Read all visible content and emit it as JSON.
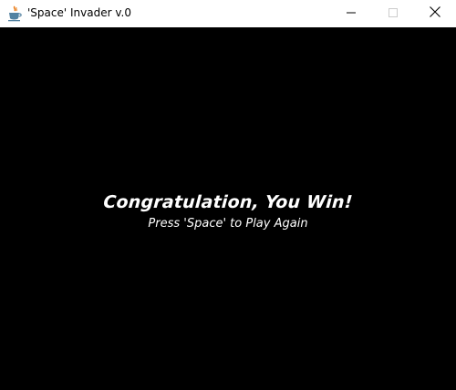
{
  "window": {
    "title": "'Space' Invader v.0",
    "icon": "java-coffee-cup-icon",
    "controls": {
      "minimize_icon": "minimize-icon",
      "maximize_icon": "maximize-icon",
      "close_icon": "close-icon"
    }
  },
  "game": {
    "background_color": "#000000",
    "text_color": "#ffffff",
    "win_message": "Congratulation, You Win!",
    "prompt": "Press 'Space' to Play Again"
  }
}
